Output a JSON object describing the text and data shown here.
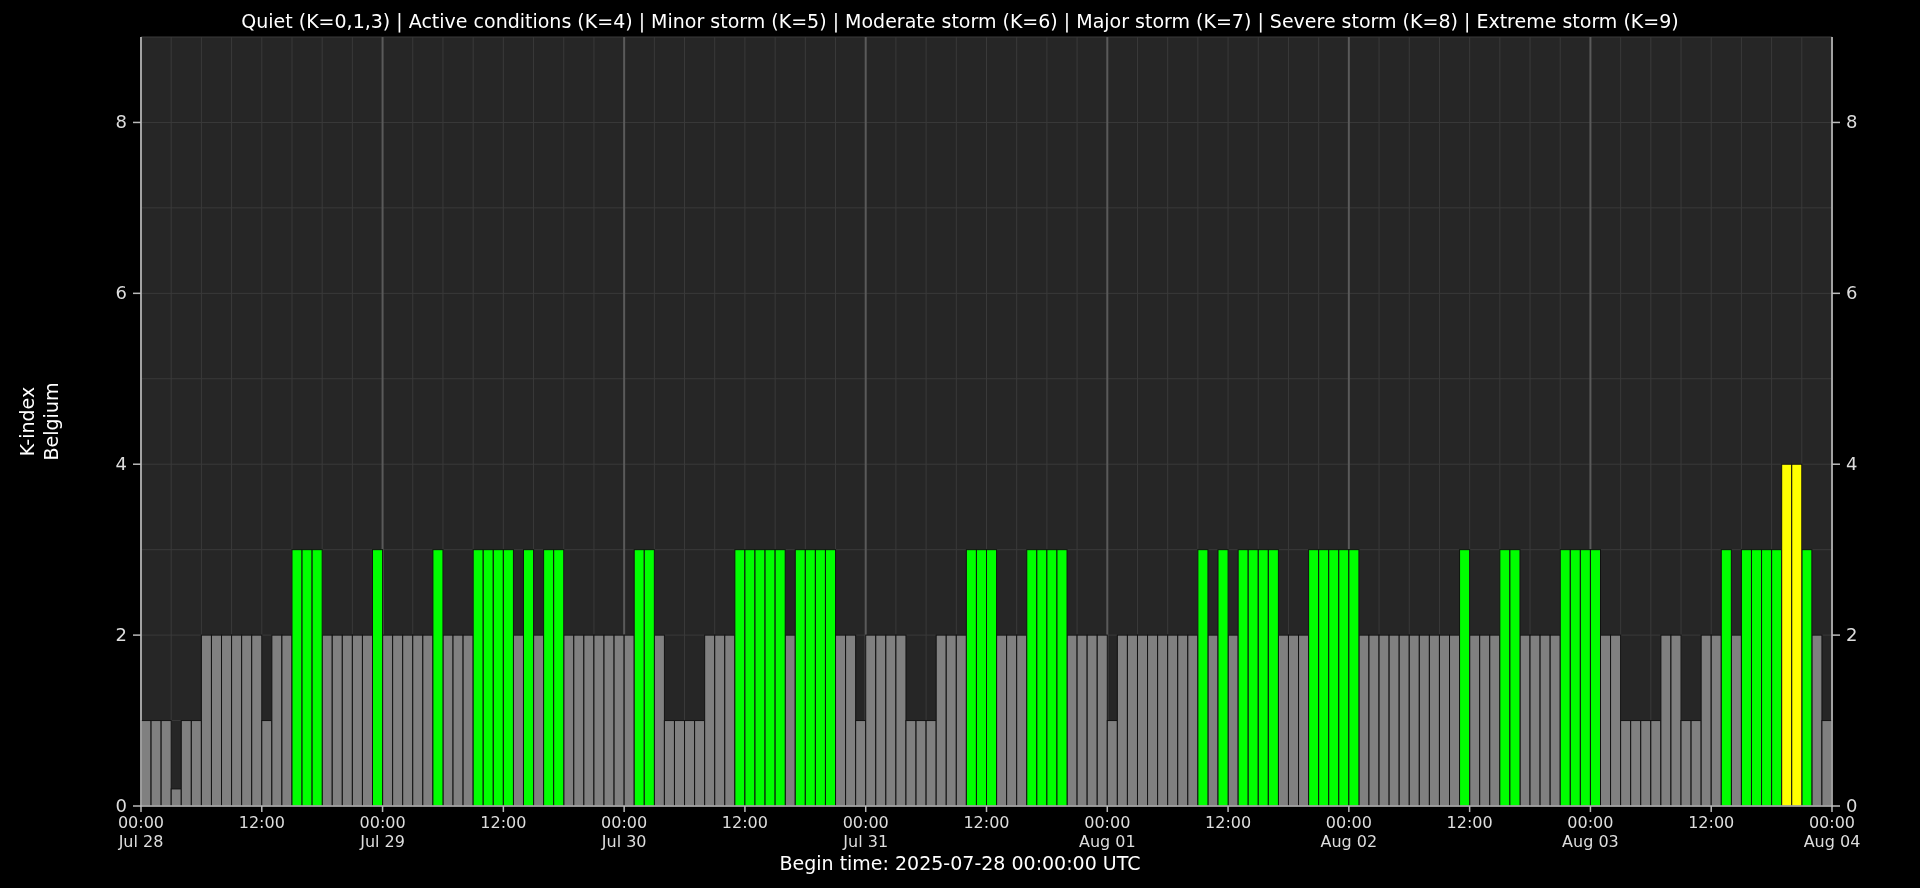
{
  "chart_data": {
    "type": "bar",
    "title": "Quiet (K=0,1,3) | Active conditions (K=4) | Minor storm (K=5) | Moderate storm (K=6) | Major storm (K=7) | Severe storm (K=8) | Extreme storm (K=9)",
    "xlabel": "Begin time: 2025-07-28 00:00:00 UTC",
    "ylabel": "K-index\nBelgium",
    "grid": true,
    "ylim": [
      0,
      9
    ],
    "yticks": [
      {
        "value": 0,
        "label": "0"
      },
      {
        "value": 2,
        "label": "2"
      },
      {
        "value": 4,
        "label": "4"
      },
      {
        "value": 6,
        "label": "6"
      },
      {
        "value": 8,
        "label": "8"
      }
    ],
    "categories": [
      "00:00\nJul 28",
      null,
      null,
      null,
      null,
      null,
      null,
      null,
      null,
      null,
      null,
      null,
      "12:00",
      null,
      null,
      null,
      null,
      null,
      null,
      null,
      null,
      null,
      null,
      null,
      "00:00\nJul 29",
      null,
      null,
      null,
      null,
      null,
      null,
      null,
      null,
      null,
      null,
      null,
      "12:00",
      null,
      null,
      null,
      null,
      null,
      null,
      null,
      null,
      null,
      null,
      null,
      "00:00\nJul 30",
      null,
      null,
      null,
      null,
      null,
      null,
      null,
      null,
      null,
      null,
      null,
      "12:00",
      null,
      null,
      null,
      null,
      null,
      null,
      null,
      null,
      null,
      null,
      null,
      "00:00\nJul 31",
      null,
      null,
      null,
      null,
      null,
      null,
      null,
      null,
      null,
      null,
      null,
      "12:00",
      null,
      null,
      null,
      null,
      null,
      null,
      null,
      null,
      null,
      null,
      null,
      "00:00\nAug 01",
      null,
      null,
      null,
      null,
      null,
      null,
      null,
      null,
      null,
      null,
      null,
      "12:00",
      null,
      null,
      null,
      null,
      null,
      null,
      null,
      null,
      null,
      null,
      null,
      "00:00\nAug 02",
      null,
      null,
      null,
      null,
      null,
      null,
      null,
      null,
      null,
      null,
      null,
      "12:00",
      null,
      null,
      null,
      null,
      null,
      null,
      null,
      null,
      null,
      null,
      null,
      "00:00\nAug 03",
      null,
      null,
      null,
      null,
      null,
      null,
      null,
      null,
      null,
      null,
      null,
      "12:00",
      null,
      null,
      null,
      null,
      null,
      null,
      null,
      null,
      null,
      null,
      null,
      "00:00\nAug 04"
    ],
    "series": [
      {
        "color": "#808080",
        "values": [
          1,
          1,
          1,
          0.2,
          1,
          1,
          2,
          2,
          2,
          2,
          2,
          2,
          1,
          2,
          2,
          null,
          null,
          null,
          2,
          2,
          2,
          2,
          2,
          null,
          2,
          2,
          2,
          2,
          2,
          null,
          2,
          2,
          2,
          null,
          null,
          null,
          null,
          2,
          null,
          2,
          null,
          null,
          2,
          2,
          2,
          2,
          2,
          2,
          2,
          null,
          null,
          2,
          1,
          1,
          1,
          1,
          2,
          2,
          2,
          null,
          null,
          null,
          null,
          null,
          2,
          null,
          null,
          null,
          null,
          2,
          2,
          1,
          2,
          2,
          2,
          2,
          1,
          1,
          1,
          2,
          2,
          2,
          null,
          null,
          null,
          2,
          2,
          2,
          null,
          null,
          null,
          null,
          2,
          2,
          2,
          2,
          1,
          2,
          2,
          2,
          2,
          2,
          2,
          2,
          2,
          null,
          2,
          null,
          2,
          null,
          null,
          null,
          null,
          2,
          2,
          2,
          null,
          null,
          null,
          null,
          null,
          2,
          2,
          2,
          2,
          2,
          2,
          2,
          2,
          2,
          2,
          null,
          2,
          2,
          2,
          null,
          null,
          2,
          2,
          2,
          2,
          null,
          null,
          null,
          null,
          2,
          2,
          1,
          1,
          1,
          1,
          2,
          2,
          1,
          1,
          2,
          2,
          null,
          2,
          null,
          null,
          null,
          null,
          null,
          null,
          null,
          2,
          1,
          null
        ]
      },
      {
        "color": "#00ff00",
        "values": [
          null,
          null,
          null,
          null,
          null,
          null,
          null,
          null,
          null,
          null,
          null,
          null,
          null,
          null,
          null,
          3,
          3,
          3,
          null,
          null,
          null,
          null,
          null,
          3,
          null,
          null,
          null,
          null,
          null,
          3,
          null,
          null,
          null,
          3,
          3,
          3,
          3,
          null,
          3,
          null,
          3,
          3,
          null,
          null,
          null,
          null,
          null,
          null,
          null,
          3,
          3,
          null,
          null,
          null,
          null,
          null,
          null,
          null,
          null,
          3,
          3,
          3,
          3,
          3,
          null,
          3,
          3,
          3,
          3,
          null,
          null,
          null,
          null,
          null,
          null,
          null,
          null,
          null,
          null,
          null,
          null,
          null,
          3,
          3,
          3,
          null,
          null,
          null,
          3,
          3,
          3,
          3,
          null,
          null,
          null,
          null,
          null,
          null,
          null,
          null,
          null,
          null,
          null,
          null,
          null,
          3,
          null,
          3,
          null,
          3,
          3,
          3,
          3,
          null,
          null,
          null,
          3,
          3,
          3,
          3,
          3,
          null,
          null,
          null,
          null,
          null,
          null,
          null,
          null,
          null,
          null,
          3,
          null,
          null,
          null,
          3,
          3,
          null,
          null,
          null,
          null,
          3,
          3,
          3,
          3,
          null,
          null,
          null,
          null,
          null,
          null,
          null,
          null,
          null,
          null,
          null,
          null,
          3,
          null,
          3,
          3,
          3,
          3,
          null,
          null,
          3,
          null,
          null,
          null
        ]
      },
      {
        "color": "#ffff00",
        "values": [
          null,
          null,
          null,
          null,
          null,
          null,
          null,
          null,
          null,
          null,
          null,
          null,
          null,
          null,
          null,
          null,
          null,
          null,
          null,
          null,
          null,
          null,
          null,
          null,
          null,
          null,
          null,
          null,
          null,
          null,
          null,
          null,
          null,
          null,
          null,
          null,
          null,
          null,
          null,
          null,
          null,
          null,
          null,
          null,
          null,
          null,
          null,
          null,
          null,
          null,
          null,
          null,
          null,
          null,
          null,
          null,
          null,
          null,
          null,
          null,
          null,
          null,
          null,
          null,
          null,
          null,
          null,
          null,
          null,
          null,
          null,
          null,
          null,
          null,
          null,
          null,
          null,
          null,
          null,
          null,
          null,
          null,
          null,
          null,
          null,
          null,
          null,
          null,
          null,
          null,
          null,
          null,
          null,
          null,
          null,
          null,
          null,
          null,
          null,
          null,
          null,
          null,
          null,
          null,
          null,
          null,
          null,
          null,
          null,
          null,
          null,
          null,
          null,
          null,
          null,
          null,
          null,
          null,
          null,
          null,
          null,
          null,
          null,
          null,
          null,
          null,
          null,
          null,
          null,
          null,
          null,
          null,
          null,
          null,
          null,
          null,
          null,
          null,
          null,
          null,
          null,
          null,
          null,
          null,
          null,
          null,
          null,
          null,
          null,
          null,
          null,
          null,
          null,
          null,
          null,
          null,
          null,
          null,
          null,
          null,
          null,
          null,
          null,
          4,
          4,
          null,
          null,
          null,
          null
        ]
      }
    ]
  },
  "right_axis": {
    "tick_labels": [
      "8",
      "6",
      "4",
      "2",
      "0"
    ]
  }
}
